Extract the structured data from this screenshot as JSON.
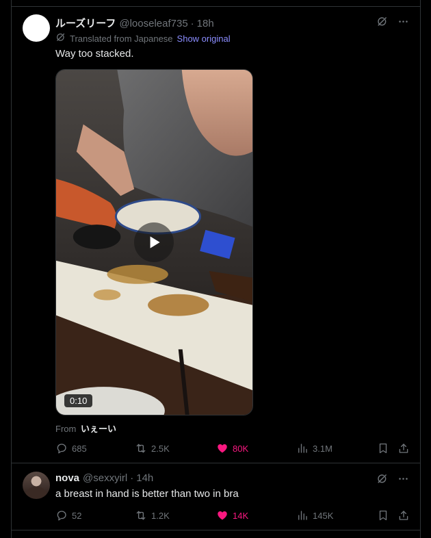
{
  "posts": [
    {
      "name": "ルーズリーフ",
      "handle": "@looseleaf735",
      "dot": "·",
      "time": "18h",
      "translation_note": "Translated from Japanese",
      "show_original": "Show original",
      "text": "Way too stacked.",
      "video": {
        "duration": "0:10"
      },
      "from_label": "From",
      "from_source": "いぇーい",
      "stats": {
        "replies": "685",
        "reposts": "2.5K",
        "likes": "80K",
        "views": "3.1M"
      },
      "liked": true
    },
    {
      "name": "nova",
      "handle": "@sexxyirl",
      "dot": "·",
      "time": "14h",
      "text": "a breast in hand is better than two in bra",
      "stats": {
        "replies": "52",
        "reposts": "1.2K",
        "likes": "14K",
        "views": "145K"
      },
      "liked": true
    }
  ],
  "colors": {
    "background": "#000000",
    "text": "#e7e9ea",
    "muted": "#71767b",
    "like": "#f91880",
    "link": "#8b8dff",
    "border": "#2f3336"
  },
  "icons": [
    "grok-icon",
    "more-icon",
    "translate-icon",
    "play-icon",
    "reply-icon",
    "repost-icon",
    "like-icon",
    "views-icon",
    "bookmark-icon",
    "share-icon"
  ]
}
